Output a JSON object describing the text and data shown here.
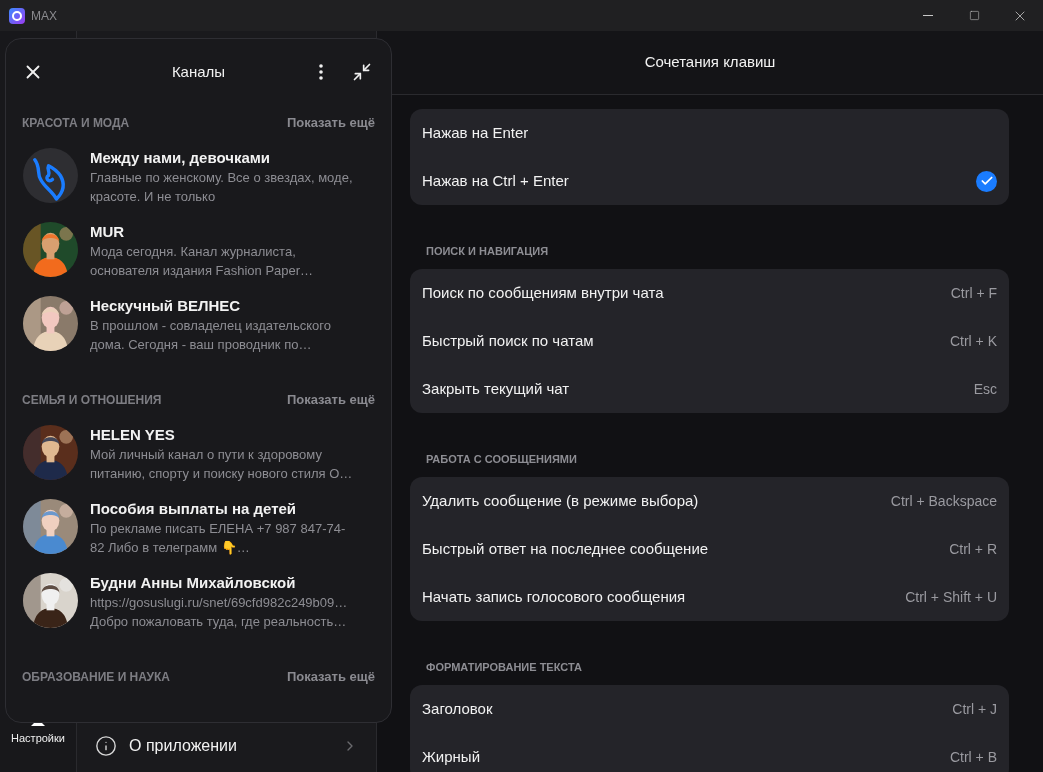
{
  "window": {
    "title": "MAX"
  },
  "sidebar": {
    "active_label": "Настройки"
  },
  "settings_list": {
    "items": [
      {
        "label": "О приложении"
      }
    ]
  },
  "popup": {
    "title": "Каналы",
    "sections": [
      {
        "title": "КРАСОТА И МОДА",
        "more": "Показать ещё",
        "channels": [
          {
            "kind": "logo",
            "name": "Между нами, девочками",
            "lines": [
              "Главные по женскому. Все о звездах, моде,",
              "красоте. И не только"
            ]
          },
          {
            "kind": "picture",
            "name": "MUR",
            "lines": [
              "Мода сегодня. Канал журналиста,",
              "основателя издания Fashion Paper…"
            ]
          },
          {
            "kind": "picture",
            "name": "Нескучный ВЕЛНЕС",
            "lines": [
              "В прошлом - совладелец издательского",
              "дома. Сегодня - ваш проводник по…"
            ]
          }
        ]
      },
      {
        "title": "СЕМЬЯ И ОТНОШЕНИЯ",
        "more": "Показать ещё",
        "channels": [
          {
            "kind": "picture",
            "name": "HELEN YES",
            "lines": [
              "Мой личный канал о пути к здоровому",
              "питанию, спорту и поиску нового стиля О…"
            ]
          },
          {
            "kind": "picture",
            "name": "Пособия выплаты на детей",
            "lines": [
              "По рекламе писать ЕЛЕНА +7 987 847-74-",
              "82 Либо в телеграмм 👇…"
            ]
          },
          {
            "kind": "picture",
            "name": "Будни Анны Михайловской",
            "lines": [
              "https://gosuslugi.ru/snet/69cfd982c249b09…",
              "Добро пожаловать туда, где реальность…"
            ]
          }
        ]
      },
      {
        "title": "ОБРАЗОВАНИЕ И НАУКА",
        "more": "Показать ещё"
      }
    ]
  },
  "shortcuts": {
    "title": "Сочетания клавиш",
    "groups": [
      {
        "rows": [
          {
            "kind": "option",
            "label": "Нажав на Enter",
            "checked": false
          },
          {
            "kind": "option",
            "label": "Нажав на Ctrl + Enter",
            "checked": true
          }
        ]
      },
      {
        "title": "ПОИСК И НАВИГАЦИЯ",
        "rows": [
          {
            "kind": "shortcut",
            "label": "Поиск по сообщениям внутри чата",
            "keys": "Ctrl + F"
          },
          {
            "kind": "shortcut",
            "label": "Быстрый поиск по чатам",
            "keys": "Ctrl + K"
          },
          {
            "kind": "shortcut",
            "label": "Закрыть текущий чат",
            "keys": "Esc"
          }
        ]
      },
      {
        "title": "РАБОТА С СООБЩЕНИЯМИ",
        "rows": [
          {
            "kind": "shortcut",
            "label": "Удалить сообщение (в режиме выбора)",
            "keys": "Ctrl + Backspace"
          },
          {
            "kind": "shortcut",
            "label": "Быстрый ответ на последнее сообщение",
            "keys": "Ctrl + R"
          },
          {
            "kind": "shortcut",
            "label": "Начать запись голосового сообщения",
            "keys": "Ctrl + Shift + U"
          }
        ]
      },
      {
        "title": "ФОРМАТИРОВАНИЕ ТЕКСТА",
        "rows": [
          {
            "kind": "shortcut",
            "label": "Заголовок",
            "keys": "Ctrl + J"
          },
          {
            "kind": "shortcut",
            "label": "Жирный",
            "keys": "Ctrl + B"
          }
        ]
      }
    ]
  }
}
